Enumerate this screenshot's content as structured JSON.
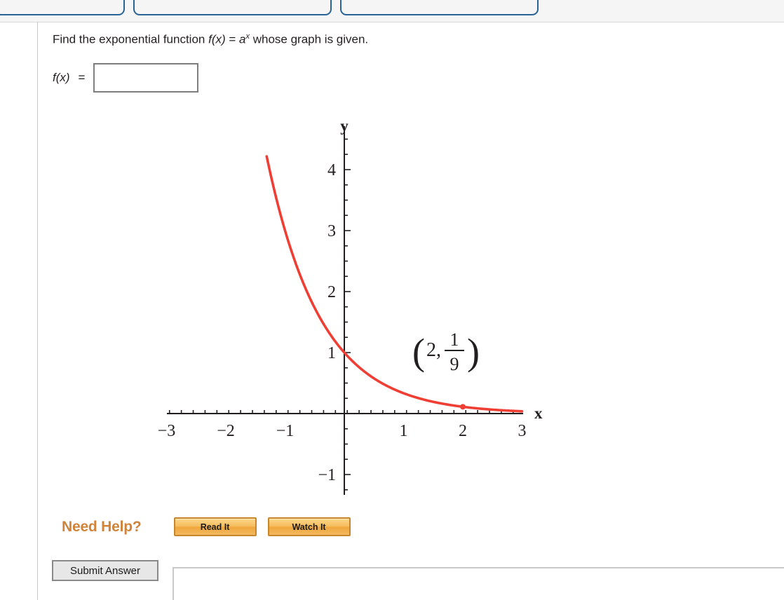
{
  "tabs": [
    {
      "label": ""
    },
    {
      "label": ""
    },
    {
      "label": ""
    }
  ],
  "question": {
    "prefix": "Find the exponential function ",
    "fn": "f(x)",
    "equals": " = ",
    "base": "a",
    "exponent": "x",
    "suffix": " whose graph is given."
  },
  "answer": {
    "fx_label": "f(x)",
    "equals": "=",
    "value": "",
    "placeholder": ""
  },
  "help": {
    "label": "Need Help?",
    "read_it": "Read It",
    "watch_it": "Watch It"
  },
  "submit": {
    "label": "Submit Answer"
  },
  "colors": {
    "curve": "#ef3f34",
    "axis": "#231f20",
    "accent_orange": "#d0843a",
    "tab_blue": "#2a6496"
  },
  "chart_data": {
    "type": "line",
    "title": "",
    "xlabel": "x",
    "ylabel": "y",
    "xlim": [
      -3.15,
      3.15
    ],
    "ylim": [
      -1.25,
      4.5
    ],
    "grid": false,
    "legend": null,
    "xticks": [
      -3,
      -2,
      -1,
      1,
      2,
      3
    ],
    "xtick_labels": [
      "−3",
      "−2",
      "−1",
      "1",
      "2",
      "3"
    ],
    "yticks": [
      -1,
      1,
      2,
      3,
      4
    ],
    "ytick_labels": [
      "−1",
      "1",
      "2",
      "3",
      "4"
    ],
    "minor_tick_step_x": 0.2,
    "minor_tick_step_y": 0.25,
    "function": "f(x) = (1/3)^x",
    "base": 0.3333333,
    "series": [
      {
        "name": "f(x) = a^x",
        "color": "#ef3f34",
        "x": [
          -1.31,
          -1.2,
          -1.0,
          -0.8,
          -0.6,
          -0.4,
          -0.2,
          0.0,
          0.2,
          0.4,
          0.6,
          0.8,
          1.0,
          1.2,
          1.4,
          1.6,
          1.8,
          2.0,
          2.2,
          2.4,
          2.6,
          2.8,
          3.0
        ],
        "y": [
          4.46,
          3.74,
          3.0,
          2.41,
          1.93,
          1.55,
          1.25,
          1.0,
          0.8,
          0.64,
          0.51,
          0.41,
          0.333,
          0.267,
          0.214,
          0.172,
          0.138,
          0.111,
          0.089,
          0.071,
          0.057,
          0.046,
          0.037
        ]
      }
    ],
    "annotations": [
      {
        "label_x": "2",
        "label_numerator": "1",
        "label_denominator": "9",
        "point_x": 2,
        "point_y": 0.1111,
        "marker": "dot",
        "marker_color": "#ef3f34"
      }
    ]
  }
}
